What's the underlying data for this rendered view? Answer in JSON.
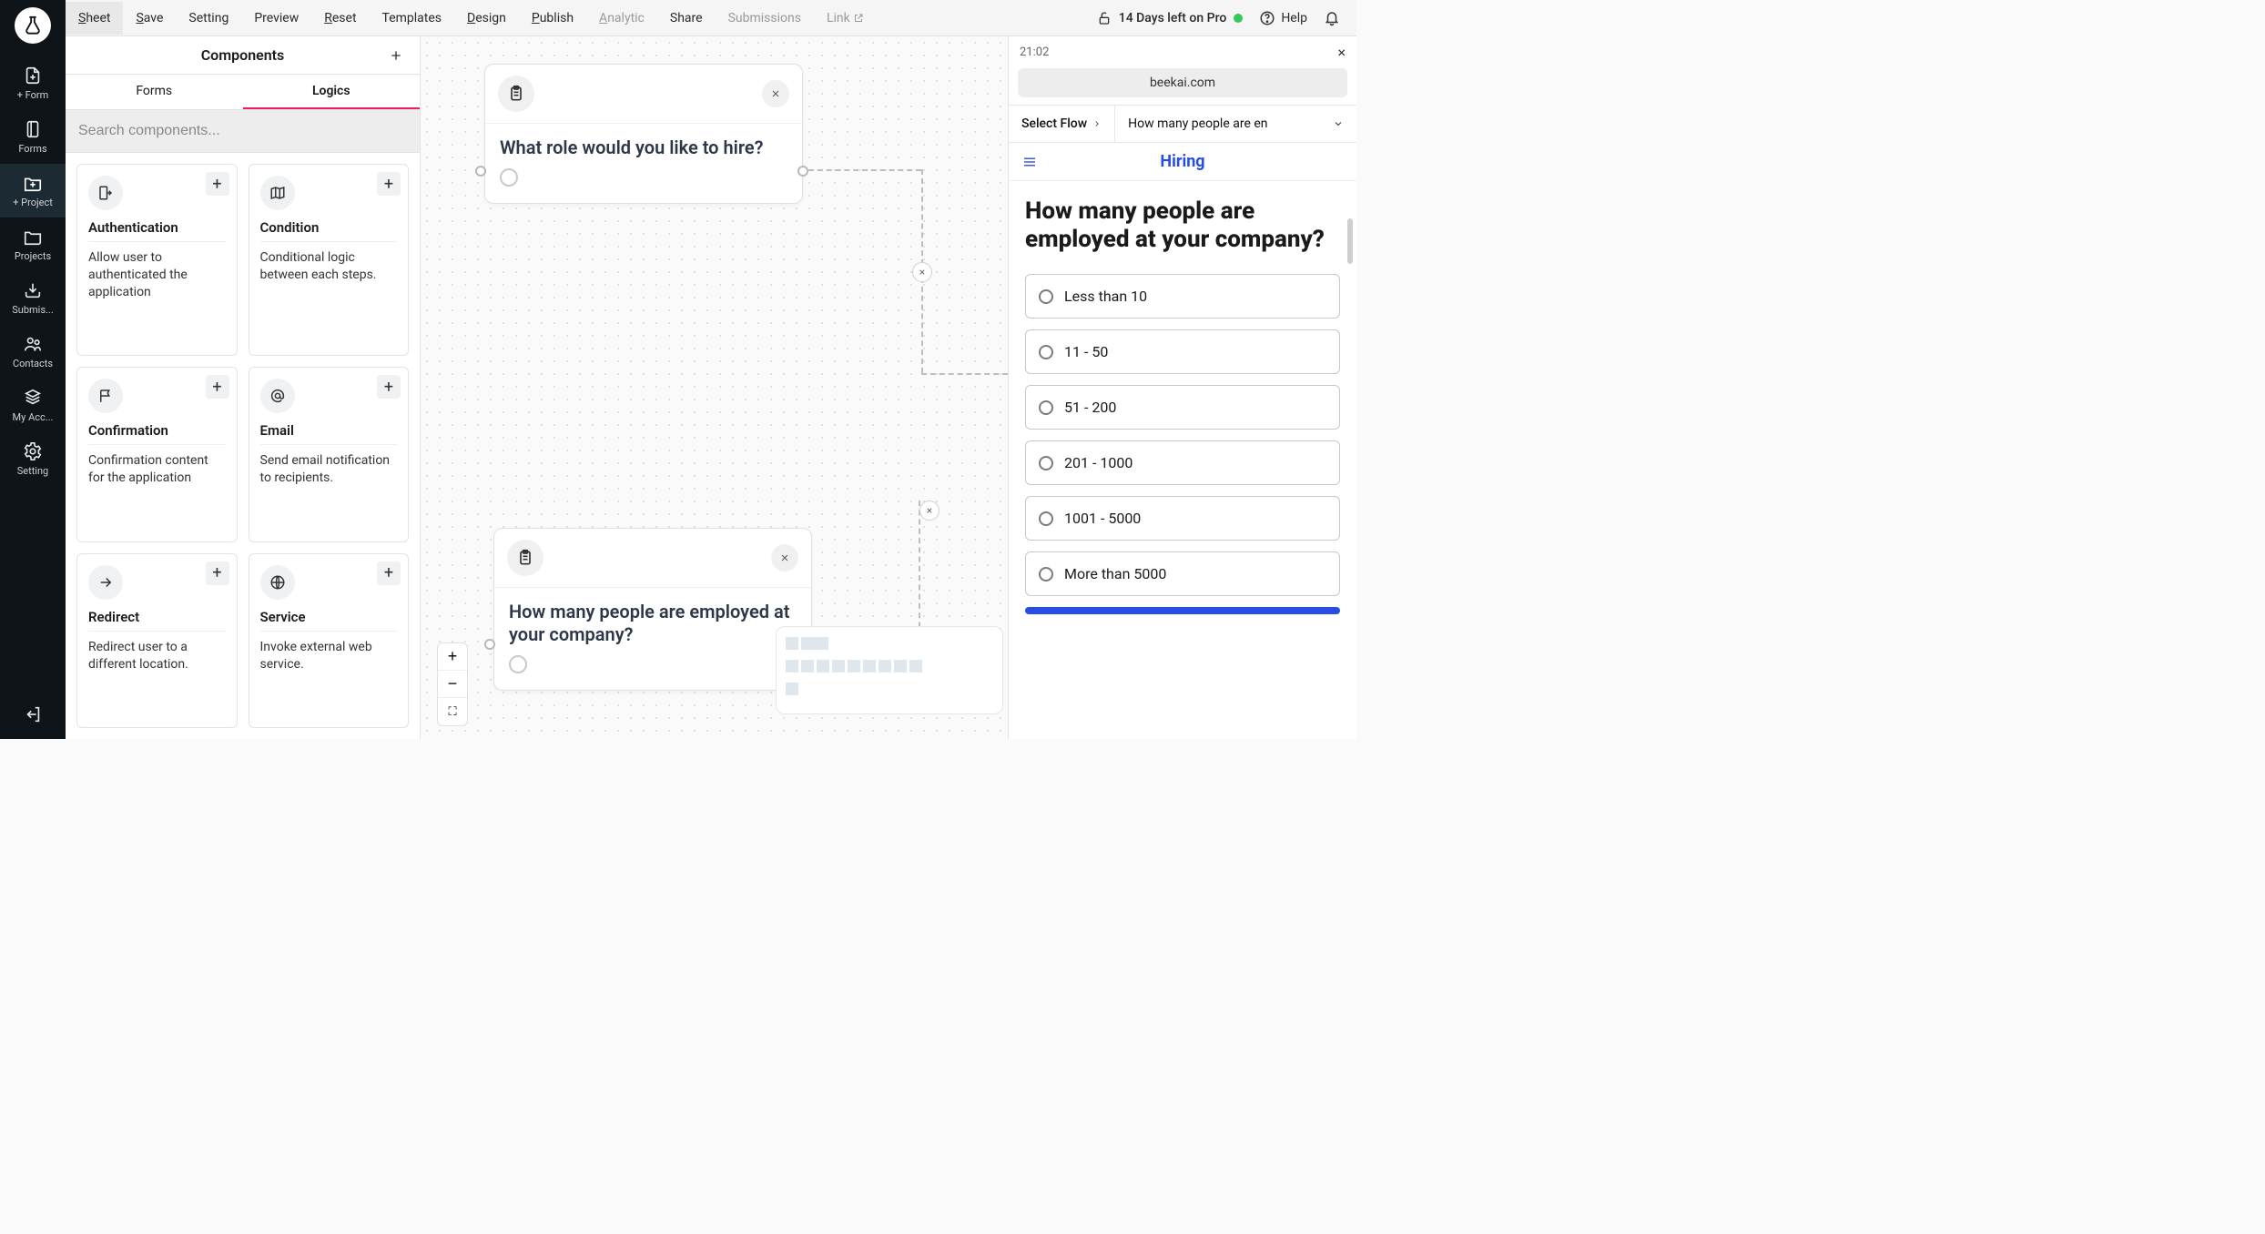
{
  "leftbar": {
    "items": [
      {
        "label": "+ Form"
      },
      {
        "label": "Forms"
      },
      {
        "label": "+ Project"
      },
      {
        "label": "Projects"
      },
      {
        "label": "Submis..."
      },
      {
        "label": "Contacts"
      },
      {
        "label": "My Acc..."
      },
      {
        "label": "Setting"
      }
    ]
  },
  "topbar": {
    "menus": [
      {
        "u": "S",
        "rest": "heet"
      },
      {
        "u": "S",
        "rest": "ave"
      },
      {
        "u": "",
        "rest": "Setting"
      },
      {
        "u": "",
        "rest": "Preview"
      },
      {
        "u": "R",
        "rest": "eset"
      },
      {
        "u": "",
        "rest": "Templates"
      },
      {
        "u": "D",
        "rest": "esign"
      },
      {
        "u": "P",
        "rest": "ublish"
      },
      {
        "u": "A",
        "rest": "nalytic"
      },
      {
        "u": "",
        "rest": "Share"
      },
      {
        "u": "",
        "rest": "Submissions"
      },
      {
        "u": "",
        "rest": "Link"
      }
    ],
    "trial": "14 Days left on Pro",
    "help": "Help"
  },
  "components": {
    "title": "Components",
    "tabs": [
      "Forms",
      "Logics"
    ],
    "search_placeholder": "Search components...",
    "cards": [
      {
        "title": "Authentication",
        "desc": "Allow user to authenticated the application"
      },
      {
        "title": "Condition",
        "desc": "Conditional logic between each steps."
      },
      {
        "title": "Confirmation",
        "desc": "Confirmation content for the application"
      },
      {
        "title": "Email",
        "desc": "Send email notification to recipients."
      },
      {
        "title": "Redirect",
        "desc": "Redirect user to a different location."
      },
      {
        "title": "Service",
        "desc": "Invoke external web service."
      }
    ]
  },
  "canvas": {
    "node1": "What role would you like to hire?",
    "node2": "How many people are employed at your company?"
  },
  "preview": {
    "time": "21:02",
    "addr": "beekai.com",
    "flow_label": "Select Flow",
    "flow_selected": "How many people are en",
    "brand": "Hiring",
    "question": "How many people are employed at your company?",
    "options": [
      "Less than 10",
      "11 - 50",
      "51 - 200",
      "201 - 1000",
      "1001 - 5000",
      "More than 5000"
    ]
  }
}
